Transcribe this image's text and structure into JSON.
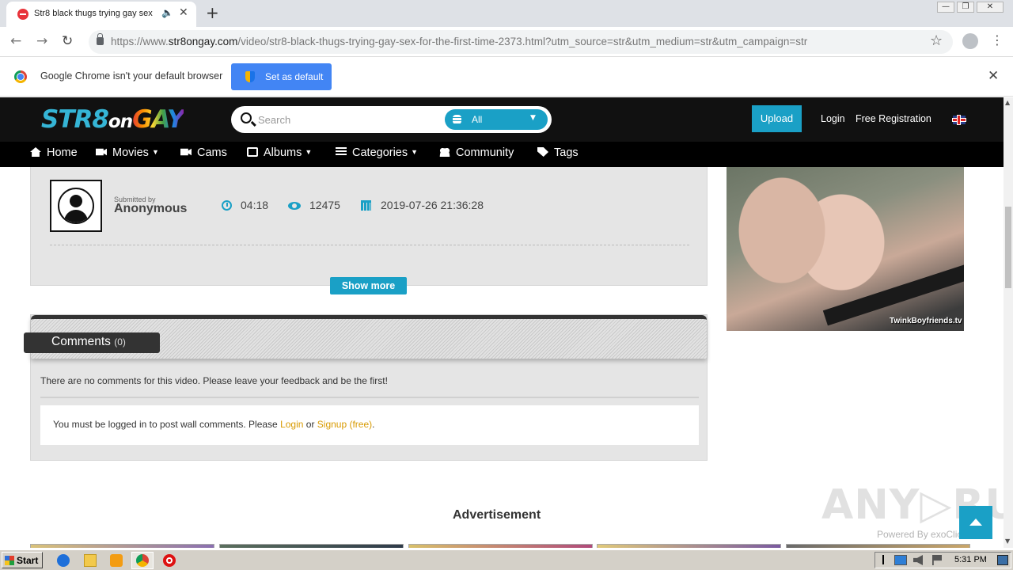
{
  "browser": {
    "tab_title": "Str8 black thugs trying gay sex",
    "tab_audio": "🔈",
    "tab_close": "✕",
    "new_tab": "+",
    "win_min": "—",
    "win_max": "❐",
    "win_close": "✕",
    "back": "←",
    "forward": "→",
    "reload": "↻",
    "url_prefix": "https://www.",
    "url_domain": "str8ongay.com",
    "url_rest": "/video/str8-black-thugs-trying-gay-sex-for-the-first-time-2373.html?utm_source=str&utm_medium=str&utm_campaign=str",
    "star": "☆",
    "menu": "⋮"
  },
  "infobar": {
    "message": "Google Chrome isn't your default browser",
    "button": "Set as default",
    "close": "✕"
  },
  "site": {
    "logo_part1": "STR8",
    "logo_part2": "on",
    "logo_part3": "GAY",
    "search_placeholder": "Search",
    "search_scope": "All",
    "search_caret": "▼",
    "upload": "Upload",
    "login": "Login",
    "register": "Free Registration"
  },
  "nav": [
    {
      "label": "Home"
    },
    {
      "label": "Movies",
      "caret": "▼"
    },
    {
      "label": "Cams"
    },
    {
      "label": "Albums",
      "caret": "▼"
    },
    {
      "label": "Categories",
      "caret": "▼"
    },
    {
      "label": "Community"
    },
    {
      "label": "Tags"
    }
  ],
  "video_info": {
    "submitted_label": "Submitted by",
    "submitter": "Anonymous",
    "duration": "04:18",
    "views": "12475",
    "date": "2019-07-26 21:36:28",
    "show_more": "Show more"
  },
  "ad": {
    "watermark": "TwinkBoyfriends.tv",
    "heading": "Advertisement"
  },
  "comments": {
    "title": "Comments",
    "count": "(0)",
    "empty_message": "There are no comments for this video. Please leave your feedback and be the first!",
    "login_prefix": "You must be logged in to post wall comments. Please ",
    "login_link": "Login",
    "or_text": " or ",
    "signup_link": "Signup (free)",
    "suffix": "."
  },
  "overlay": {
    "anyrun": "ANY▷RUN",
    "powered": "Powered By exoClick"
  },
  "scroll": {
    "up": "▲",
    "down": "▼"
  },
  "taskbar": {
    "start": "Start",
    "clock": "5:31 PM"
  }
}
